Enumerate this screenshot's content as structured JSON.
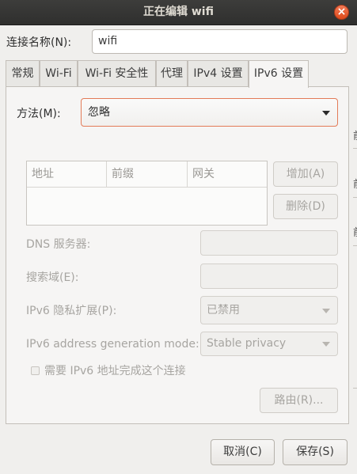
{
  "window": {
    "title": "正在编辑 wifi",
    "close_symbol": "×"
  },
  "connection": {
    "label": "连接名称(N):",
    "value": "wifi"
  },
  "tabs": [
    {
      "label": "常规"
    },
    {
      "label": "Wi-Fi"
    },
    {
      "label": "Wi-Fi 安全性"
    },
    {
      "label": "代理"
    },
    {
      "label": "IPv4 设置"
    },
    {
      "label": "IPv6 设置",
      "active": true
    }
  ],
  "ipv6": {
    "method_label": "方法(M):",
    "method_value": "忽略",
    "address_table": {
      "columns": [
        "地址",
        "前缀",
        "网关"
      ]
    },
    "add_button": "增加(A)",
    "delete_button": "删除(D)",
    "dns_label": "DNS 服务器:",
    "search_domains_label": "搜索域(E):",
    "privacy_label": "IPv6 隐私扩展(P):",
    "privacy_value": "已禁用",
    "addr_gen_label": "IPv6 address generation mode:",
    "addr_gen_value": "Stable privacy",
    "require_checkbox_label": "需要 IPv6 地址完成这个连接",
    "routes_button": "路由(R)..."
  },
  "footer": {
    "cancel_button": "取消(C)",
    "save_button": "保存(S)"
  },
  "background_window_edge": [
    "前",
    "前",
    "前"
  ],
  "colors": {
    "titlebar": "#2f2f2e",
    "close_button": "#e5582a",
    "focus_border": "#e37b58"
  }
}
